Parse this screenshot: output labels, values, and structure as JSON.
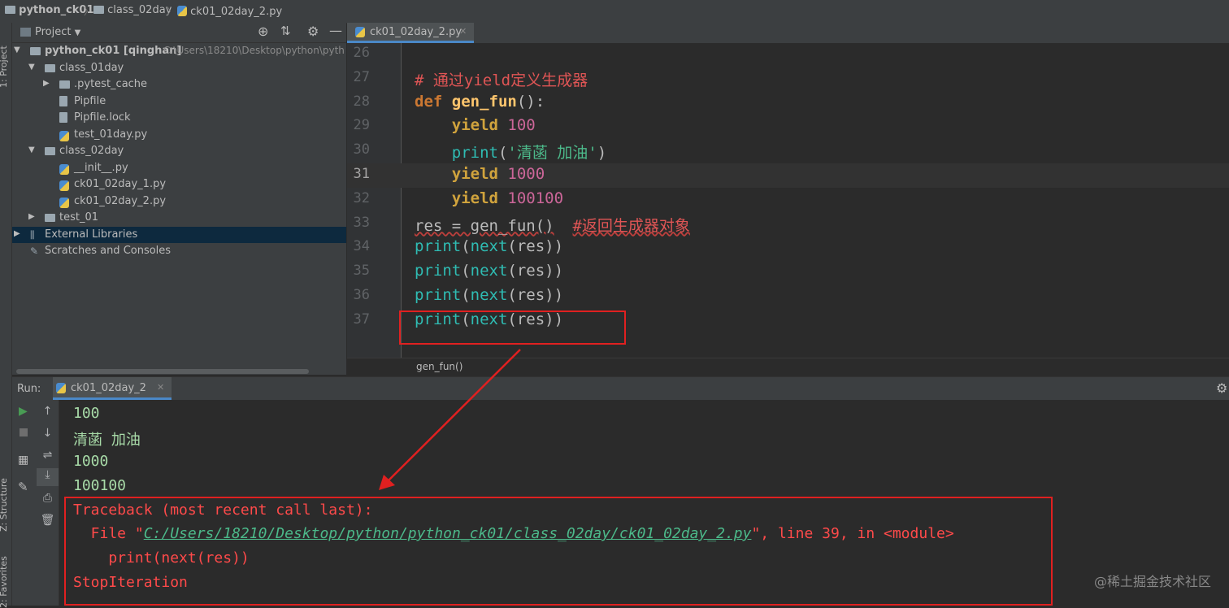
{
  "breadcrumbs": [
    "python_ck01",
    "class_02day",
    "ck01_02day_2.py"
  ],
  "left_stripe": {
    "project_label": "1: Project",
    "structure_label": "Z: Structure",
    "favorites_label": "2: Favorites"
  },
  "project_panel": {
    "title": "Project",
    "tree": [
      {
        "label": "python_ck01 [qinghan]",
        "extra": "C:\\Users\\18210\\Desktop\\python\\pyth",
        "type": "folder",
        "expanded": true,
        "depth": 0
      },
      {
        "label": "class_01day",
        "type": "folder",
        "expanded": true,
        "depth": 1
      },
      {
        "label": ".pytest_cache",
        "type": "folder",
        "expanded": false,
        "depth": 2
      },
      {
        "label": "Pipfile",
        "type": "file",
        "depth": 2
      },
      {
        "label": "Pipfile.lock",
        "type": "file",
        "depth": 2
      },
      {
        "label": "test_01day.py",
        "type": "py",
        "depth": 2
      },
      {
        "label": "class_02day",
        "type": "folder",
        "expanded": true,
        "depth": 1
      },
      {
        "label": "__init__.py",
        "type": "py",
        "depth": 2
      },
      {
        "label": "ck01_02day_1.py",
        "type": "py",
        "depth": 2
      },
      {
        "label": "ck01_02day_2.py",
        "type": "py",
        "depth": 2
      },
      {
        "label": "test_01",
        "type": "folder",
        "expanded": false,
        "depth": 1
      },
      {
        "label": "External Libraries",
        "type": "lib",
        "expanded": false,
        "depth": 0,
        "selected": true
      },
      {
        "label": "Scratches and Consoles",
        "type": "scratch",
        "depth": 0
      }
    ]
  },
  "editor": {
    "tab_label": "ck01_02day_2.py",
    "current_line": "31",
    "lines": [
      {
        "num": "26",
        "tokens": []
      },
      {
        "num": "27",
        "tokens": [
          {
            "t": "# 通过yield定义生成器",
            "c": "comment"
          }
        ]
      },
      {
        "num": "28",
        "tokens": [
          {
            "t": "def ",
            "c": "kw"
          },
          {
            "t": "gen_fun",
            "c": "fn"
          },
          {
            "t": "():",
            "c": "plain"
          }
        ]
      },
      {
        "num": "29",
        "tokens": [
          {
            "t": "    ",
            "c": "plain"
          },
          {
            "t": "yield ",
            "c": "kw2"
          },
          {
            "t": "100",
            "c": "num"
          }
        ]
      },
      {
        "num": "30",
        "tokens": [
          {
            "t": "    ",
            "c": "plain"
          },
          {
            "t": "print",
            "c": "builtin"
          },
          {
            "t": "(",
            "c": "plain"
          },
          {
            "t": "'清菡 加油'",
            "c": "str"
          },
          {
            "t": ")",
            "c": "plain"
          }
        ]
      },
      {
        "num": "31",
        "tokens": [
          {
            "t": "    ",
            "c": "plain"
          },
          {
            "t": "yield ",
            "c": "kw2"
          },
          {
            "t": "1000",
            "c": "num"
          }
        ]
      },
      {
        "num": "32",
        "tokens": [
          {
            "t": "    ",
            "c": "plain"
          },
          {
            "t": "yield ",
            "c": "kw2"
          },
          {
            "t": "100100",
            "c": "num"
          }
        ]
      },
      {
        "num": "33",
        "tokens": [
          {
            "t": "res = gen_fun()",
            "c": "plain squig"
          },
          {
            "t": "  ",
            "c": "plain"
          },
          {
            "t": "#返回生成器对象",
            "c": "comment squig"
          }
        ]
      },
      {
        "num": "34",
        "tokens": [
          {
            "t": "print",
            "c": "builtin"
          },
          {
            "t": "(",
            "c": "plain"
          },
          {
            "t": "next",
            "c": "builtin"
          },
          {
            "t": "(res))",
            "c": "plain"
          }
        ]
      },
      {
        "num": "35",
        "tokens": [
          {
            "t": "print",
            "c": "builtin"
          },
          {
            "t": "(",
            "c": "plain"
          },
          {
            "t": "next",
            "c": "builtin"
          },
          {
            "t": "(res))",
            "c": "plain"
          }
        ]
      },
      {
        "num": "36",
        "tokens": [
          {
            "t": "print",
            "c": "builtin"
          },
          {
            "t": "(",
            "c": "plain"
          },
          {
            "t": "next",
            "c": "builtin"
          },
          {
            "t": "(res))",
            "c": "plain"
          }
        ]
      },
      {
        "num": "37",
        "tokens": [
          {
            "t": "print",
            "c": "builtin"
          },
          {
            "t": "(",
            "c": "plain"
          },
          {
            "t": "next",
            "c": "builtin"
          },
          {
            "t": "(res))",
            "c": "plain"
          }
        ]
      }
    ],
    "breadcrumb": "gen_fun()"
  },
  "run_panel": {
    "label": "Run:",
    "tab_label": "ck01_02day_2",
    "output": [
      {
        "text": "100",
        "kind": "normal"
      },
      {
        "text": "清菡 加油",
        "kind": "normal"
      },
      {
        "text": "1000",
        "kind": "normal"
      },
      {
        "text": "100100",
        "kind": "normal"
      }
    ],
    "traceback": {
      "header": "Traceback (most recent call last):",
      "file_prefix": "  File \"",
      "file_link": "C:/Users/18210/Desktop/python/python_ck01/class_02day/ck01_02day_2.py",
      "file_suffix": "\", line 39, in <module>",
      "code": "    print(next(res))",
      "error": "StopIteration"
    }
  },
  "watermark": "@稀土掘金技术社区",
  "colors": {
    "annotation": "#e02020",
    "accent": "#4a88c7"
  }
}
